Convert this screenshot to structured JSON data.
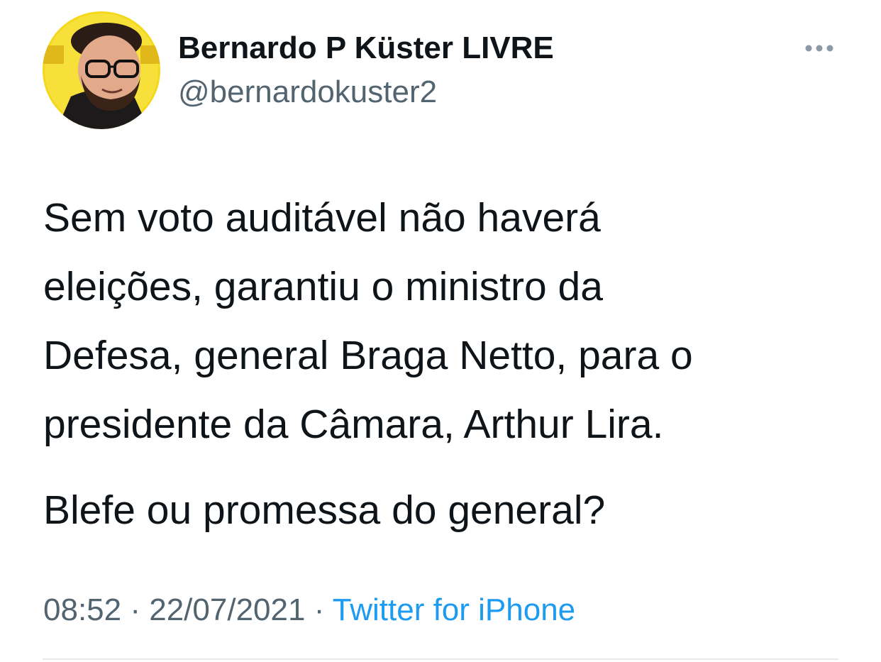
{
  "author": {
    "display_name": "Bernardo P Küster LIVRE",
    "handle": "@bernardokuster2",
    "avatar_icon": "profile-photo"
  },
  "tweet": {
    "lines": [
      "Sem voto auditável não haverá",
      "eleições, garantiu o ministro da",
      "Defesa, general Braga Netto, para o",
      "presidente da Câmara, Arthur Lira."
    ],
    "question": "Blefe ou promessa do general?"
  },
  "meta": {
    "time": "08:52",
    "separator": "·",
    "date": "22/07/2021",
    "source": "Twitter for iPhone"
  },
  "more_icon": "more-horizontal-icon",
  "colors": {
    "text": "#0f1419",
    "secondary": "#536471",
    "link": "#1d9bf0",
    "avatar_background": "#f4d81c",
    "divider": "#e7e9ea"
  }
}
